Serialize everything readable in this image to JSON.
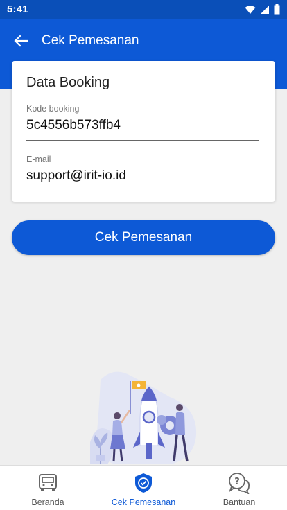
{
  "status_bar": {
    "time": "5:41"
  },
  "app_bar": {
    "title": "Cek Pemesanan"
  },
  "card": {
    "title": "Data Booking",
    "kode_label": "Kode booking",
    "kode_value": "5c4556b573ffb4",
    "email_label": "E-mail",
    "email_value": "support@irit-io.id"
  },
  "primary_button": {
    "label": "Cek Pemesanan"
  },
  "bottom_nav": {
    "items": [
      {
        "label": "Beranda",
        "icon": "bus-icon",
        "active": false
      },
      {
        "label": "Cek Pemesanan",
        "icon": "shield-check-icon",
        "active": true
      },
      {
        "label": "Bantuan",
        "icon": "help-chat-icon",
        "active": false
      }
    ]
  },
  "colors": {
    "primary": "#0d59d6",
    "status_bar": "#0a4fb8",
    "background": "#efefef"
  }
}
